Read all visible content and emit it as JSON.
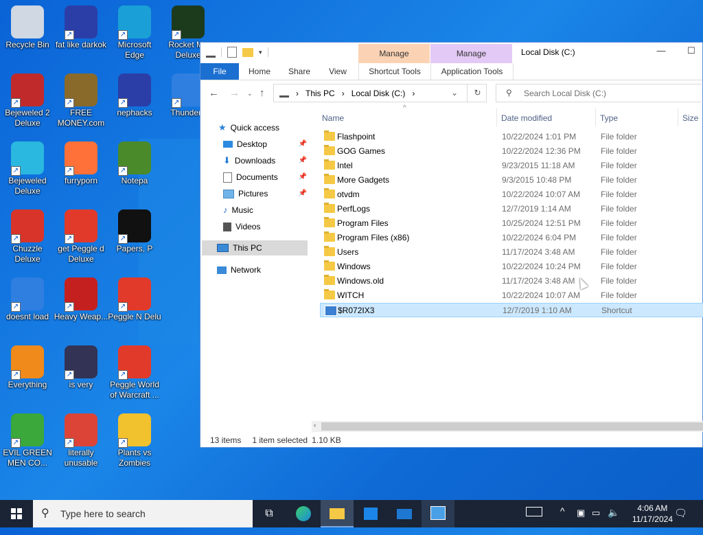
{
  "desktop": {
    "icons": [
      {
        "label": "Recycle Bin",
        "icon": "recycle-bin-icon",
        "color": "#cfd8e3"
      },
      {
        "label": "fat like darkok",
        "icon": "mpi-logo-icon",
        "color": "#2b3ea8"
      },
      {
        "label": "Microsoft Edge",
        "icon": "edge-icon",
        "color": "#1aa0d6"
      },
      {
        "label": "Rocket Ma Deluxe",
        "icon": "rocket-mania-icon",
        "color": "#1c3b1c"
      },
      {
        "label": "Bejeweled 2 Deluxe",
        "icon": "bejeweled2-icon",
        "color": "#c02a2a"
      },
      {
        "label": "FREE MONEY.com",
        "icon": "money-bag-icon",
        "color": "#8a6a2a"
      },
      {
        "label": "nephacks",
        "icon": "mpi-logo-icon",
        "color": "#2b3ea8"
      },
      {
        "label": "Thunderb",
        "icon": "thunderbird-icon",
        "color": "#2f7fe0"
      },
      {
        "label": "Bejeweled Deluxe",
        "icon": "bejeweled-icon",
        "color": "#2ab7e0"
      },
      {
        "label": "furryporn",
        "icon": "firefox-icon",
        "color": "#ff7139"
      },
      {
        "label": "Notepa",
        "icon": "notepad-icon",
        "color": "#4a8a2a"
      },
      {
        "label": "Chuzzle Deluxe",
        "icon": "chuzzle-icon",
        "color": "#d8342a"
      },
      {
        "label": "get Peggle d Deluxe",
        "icon": "peggle-icon",
        "color": "#e23a2a"
      },
      {
        "label": "Papers, P",
        "icon": "papers-please-icon",
        "color": "#111111"
      },
      {
        "label": "doesnt load",
        "icon": "thunderbird-icon",
        "color": "#2f7fe0"
      },
      {
        "label": "Heavy Weap...",
        "icon": "radiation-icon",
        "color": "#c42020"
      },
      {
        "label": "Peggle N Delu",
        "icon": "peggle-icon",
        "color": "#e23a2a"
      },
      {
        "label": "Everything",
        "icon": "magnifier-icon",
        "color": "#f08a1a"
      },
      {
        "label": "is very",
        "icon": "mpi-shield-icon",
        "color": "#333355"
      },
      {
        "label": "Peggle World of Warcraft ...",
        "icon": "peggle-icon",
        "color": "#e23a2a"
      },
      {
        "label": "EVIL GREEN MEN CO...",
        "icon": "green-men-icon",
        "color": "#3aa83a"
      },
      {
        "label": "literally unusable",
        "icon": "chrome-icon",
        "color": "#db4437"
      },
      {
        "label": "Plants vs Zombies",
        "icon": "plants-vs-zombies-icon",
        "color": "#f2c12e"
      }
    ]
  },
  "explorer": {
    "title": "Local Disk (C:)",
    "manage_1": "Manage",
    "manage_2": "Manage",
    "ribbon_tabs": [
      "File",
      "Home",
      "Share",
      "View",
      "Shortcut Tools",
      "Application Tools"
    ],
    "breadcrumb": [
      "This PC",
      "Local Disk (C:)"
    ],
    "search_placeholder": "Search Local Disk (C:)",
    "nav": {
      "quick_access": "Quick access",
      "items": [
        "Desktop",
        "Downloads",
        "Documents",
        "Pictures",
        "Music",
        "Videos"
      ],
      "this_pc": "This PC",
      "network": "Network"
    },
    "columns": [
      "Name",
      "Date modified",
      "Type",
      "Size"
    ],
    "files": [
      {
        "name": "Flashpoint",
        "date": "10/22/2024 1:01 PM",
        "type": "File folder"
      },
      {
        "name": "GOG Games",
        "date": "10/22/2024 12:36 PM",
        "type": "File folder"
      },
      {
        "name": "Intel",
        "date": "9/23/2015 11:18 AM",
        "type": "File folder"
      },
      {
        "name": "More Gadgets",
        "date": "9/3/2015 10:48 PM",
        "type": "File folder"
      },
      {
        "name": "otvdm",
        "date": "10/22/2024 10:07 AM",
        "type": "File folder"
      },
      {
        "name": "PerfLogs",
        "date": "12/7/2019 1:14 AM",
        "type": "File folder"
      },
      {
        "name": "Program Files",
        "date": "10/25/2024 12:51 PM",
        "type": "File folder"
      },
      {
        "name": "Program Files (x86)",
        "date": "10/22/2024 6:04 PM",
        "type": "File folder"
      },
      {
        "name": "Users",
        "date": "11/17/2024 3:48 AM",
        "type": "File folder"
      },
      {
        "name": "Windows",
        "date": "10/22/2024 10:24 PM",
        "type": "File folder"
      },
      {
        "name": "Windows.old",
        "date": "11/17/2024 3:48 AM",
        "type": "File folder"
      },
      {
        "name": "WITCH",
        "date": "10/22/2024 10:07 AM",
        "type": "File folder"
      },
      {
        "name": "$R072IX3",
        "date": "12/7/2019 1:10 AM",
        "type": "Shortcut"
      }
    ],
    "status": {
      "count": "13 items",
      "selected": "1 item selected",
      "size": "1.10 KB"
    },
    "colors": {
      "manage_orange": "#fbd3b4",
      "manage_purple": "#e3c9f5",
      "file_tab": "#1a6fd0",
      "selection": "#cce8ff"
    }
  },
  "taskbar": {
    "search_placeholder": "Type here to search",
    "time": "4:06 AM",
    "date": "11/17/2024",
    "colors": {
      "bar": "#1a2435"
    }
  }
}
